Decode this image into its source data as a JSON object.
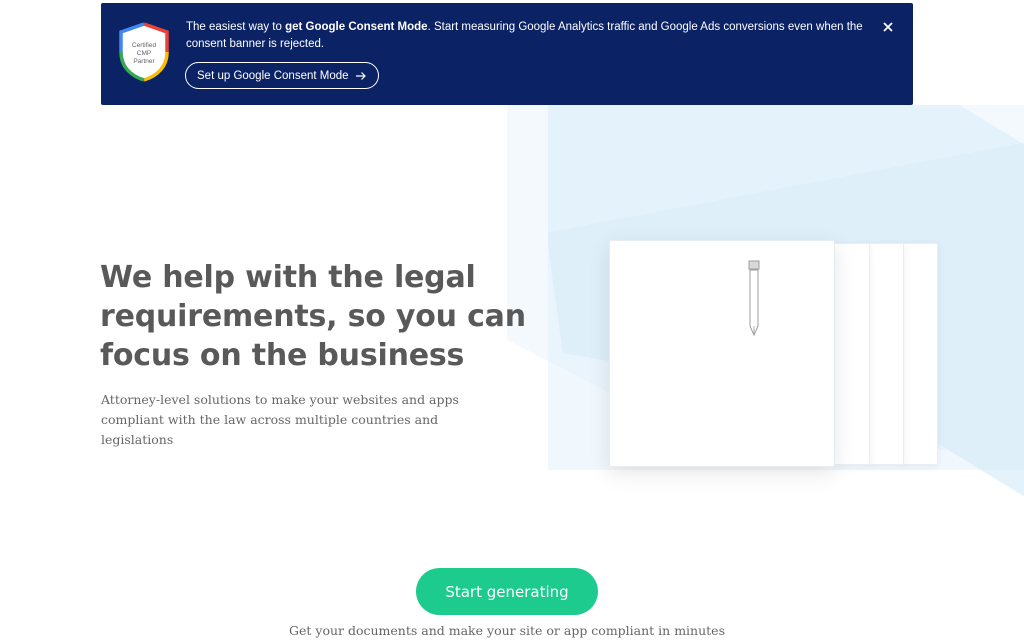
{
  "banner": {
    "badge_text": [
      "Certified",
      "CMP",
      "Partner"
    ],
    "text_prefix": "The easiest way to ",
    "text_bold": "get Google Consent Mode",
    "text_suffix": ". Start measuring Google Analytics traffic and Google Ads conversions even when the consent banner is rejected.",
    "button_label": "Set up Google Consent Mode",
    "button_icon": "arrow-right-icon",
    "close_icon": "close-icon",
    "background_color": "#0b2265"
  },
  "hero": {
    "title": "We help with the legal requirements, so you can focus on the business",
    "subtitle": "Attorney-level solutions to make your websites and apps compliant with the law across multiple countries and legislations"
  },
  "illustration": {
    "icon": "pen-icon"
  },
  "cta": {
    "button_label": "Start generating",
    "subtext": "Get your documents and make your site or app compliant in minutes",
    "accent_color": "#1ccb8d"
  }
}
